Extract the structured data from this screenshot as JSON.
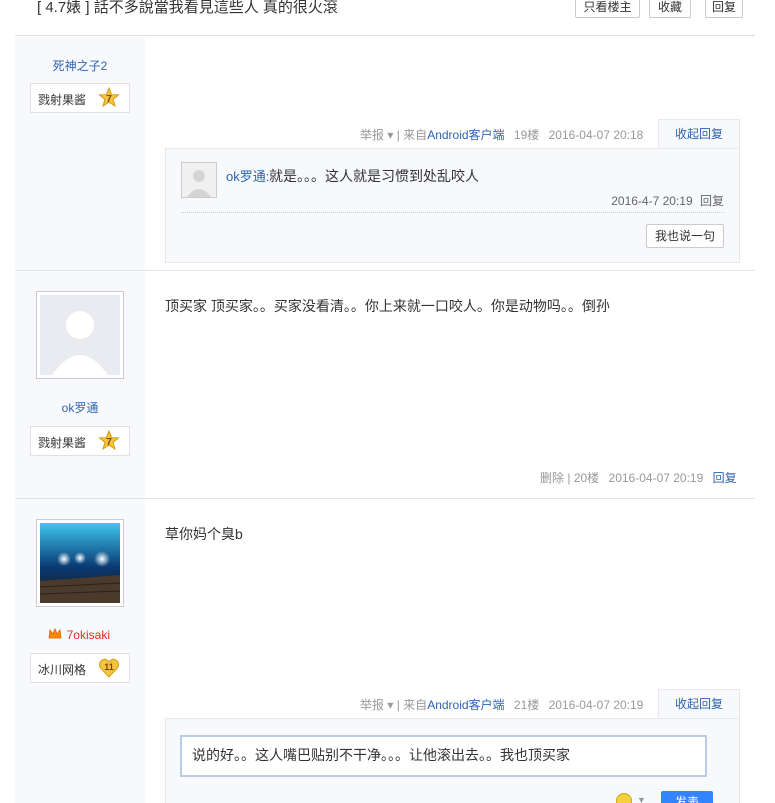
{
  "header": {
    "thread_title": "[ 4.7婊 ] 話不多說當我看見這些人 真的很火滾",
    "buttons": [
      "只看楼主",
      "收藏",
      "回复"
    ]
  },
  "posts": [
    {
      "user": "死神之子2",
      "badge_name": "戮射果酱",
      "badge_level": "7",
      "content": "",
      "meta": {
        "report": "举报",
        "source_prefix": "| 来自",
        "source": "Android客户端",
        "floor": "19楼",
        "time": "2016-04-07 20:18",
        "reply_toggle": "收起回复"
      },
      "sub_reply": {
        "user": "ok罗通:",
        "text": "就是。。。这人就是习惯到处乱咬人",
        "time": "2016-4-7 20:19",
        "reply": "回复",
        "say_button": "我也说一句"
      }
    },
    {
      "user": "ok罗通",
      "badge_name": "戮射果酱",
      "badge_level": "7",
      "content": "顶买家 顶买家。。买家没看清。。你上来就一口咬人。你是动物吗。。倒孙",
      "meta": {
        "delete": "删除",
        "separator": "|",
        "floor": "20楼",
        "time": "2016-04-07 20:19",
        "reply": "回复"
      }
    },
    {
      "user": "7okisaki",
      "badge_name": "冰川网格",
      "badge_level": "11",
      "content": "草你妈个臭b",
      "meta": {
        "report": "举报",
        "source_prefix": "| 来自",
        "source": "Android客户端",
        "floor": "21楼",
        "time": "2016-04-07 20:19",
        "reply_toggle": "收起回复"
      },
      "reply_box": {
        "text": "说的好。。这人嘴巴贴别不干净。。。让他滚出去。。我也顶买家",
        "submit": "发表"
      }
    }
  ],
  "colors": {
    "link": "#2d64b3",
    "sidebar_bg": "#f7f9fc",
    "submit": "#3385ff"
  }
}
